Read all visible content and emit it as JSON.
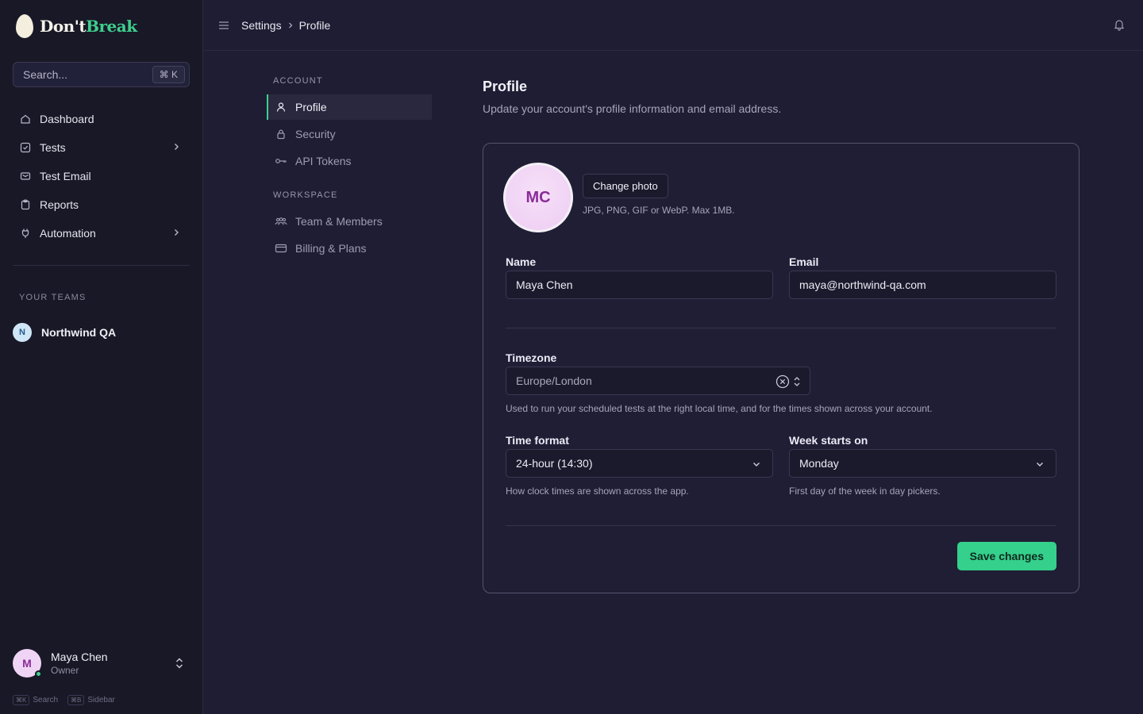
{
  "app": {
    "logo_part1": "Don't",
    "logo_part2": "Break"
  },
  "sidebar": {
    "search_placeholder": "Search...",
    "search_shortcut": "⌘ K",
    "items": [
      {
        "label": "Dashboard",
        "icon": "home-icon"
      },
      {
        "label": "Tests",
        "icon": "checkbox-icon",
        "has_children": true
      },
      {
        "label": "Test Email",
        "icon": "mail-icon"
      },
      {
        "label": "Reports",
        "icon": "clipboard-icon"
      },
      {
        "label": "Automation",
        "icon": "plug-icon",
        "has_children": true
      }
    ],
    "teams_label": "YOUR TEAMS",
    "team": {
      "initial": "N",
      "name": "Northwind QA"
    },
    "user": {
      "initial": "M",
      "name": "Maya Chen",
      "role": "Owner"
    },
    "shortcuts": [
      {
        "key": "⌘K",
        "label": "Search"
      },
      {
        "key": "⌘B",
        "label": "Sidebar"
      }
    ]
  },
  "topbar": {
    "breadcrumb": [
      "Settings",
      "Profile"
    ]
  },
  "subnav": {
    "account_label": "ACCOUNT",
    "account_items": [
      {
        "label": "Profile",
        "active": true
      },
      {
        "label": "Security"
      },
      {
        "label": "API Tokens"
      }
    ],
    "workspace_label": "WORKSPACE",
    "workspace_items": [
      {
        "label": "Team & Members"
      },
      {
        "label": "Billing & Plans"
      }
    ]
  },
  "main": {
    "title": "Profile",
    "subtitle": "Update your account's profile information and email address.",
    "avatar_initials": "MC",
    "change_photo": "Change photo",
    "photo_hint": "JPG, PNG, GIF or WebP. Max 1MB.",
    "name_label": "Name",
    "name_value": "Maya Chen",
    "email_label": "Email",
    "email_value": "maya@northwind-qa.com",
    "timezone_label": "Timezone",
    "timezone_value": "Europe/London",
    "timezone_hint": "Used to run your scheduled tests at the right local time, and for the times shown across your account.",
    "time_format_label": "Time format",
    "time_format_value": "24-hour (14:30)",
    "time_format_hint": "How clock times are shown across the app.",
    "week_start_label": "Week starts on",
    "week_start_value": "Monday",
    "week_start_hint": "First day of the week in day pickers.",
    "save_label": "Save changes"
  },
  "colors": {
    "accent": "#3ecf8e",
    "background": "#1f1d33",
    "sidebar": "#191826"
  }
}
